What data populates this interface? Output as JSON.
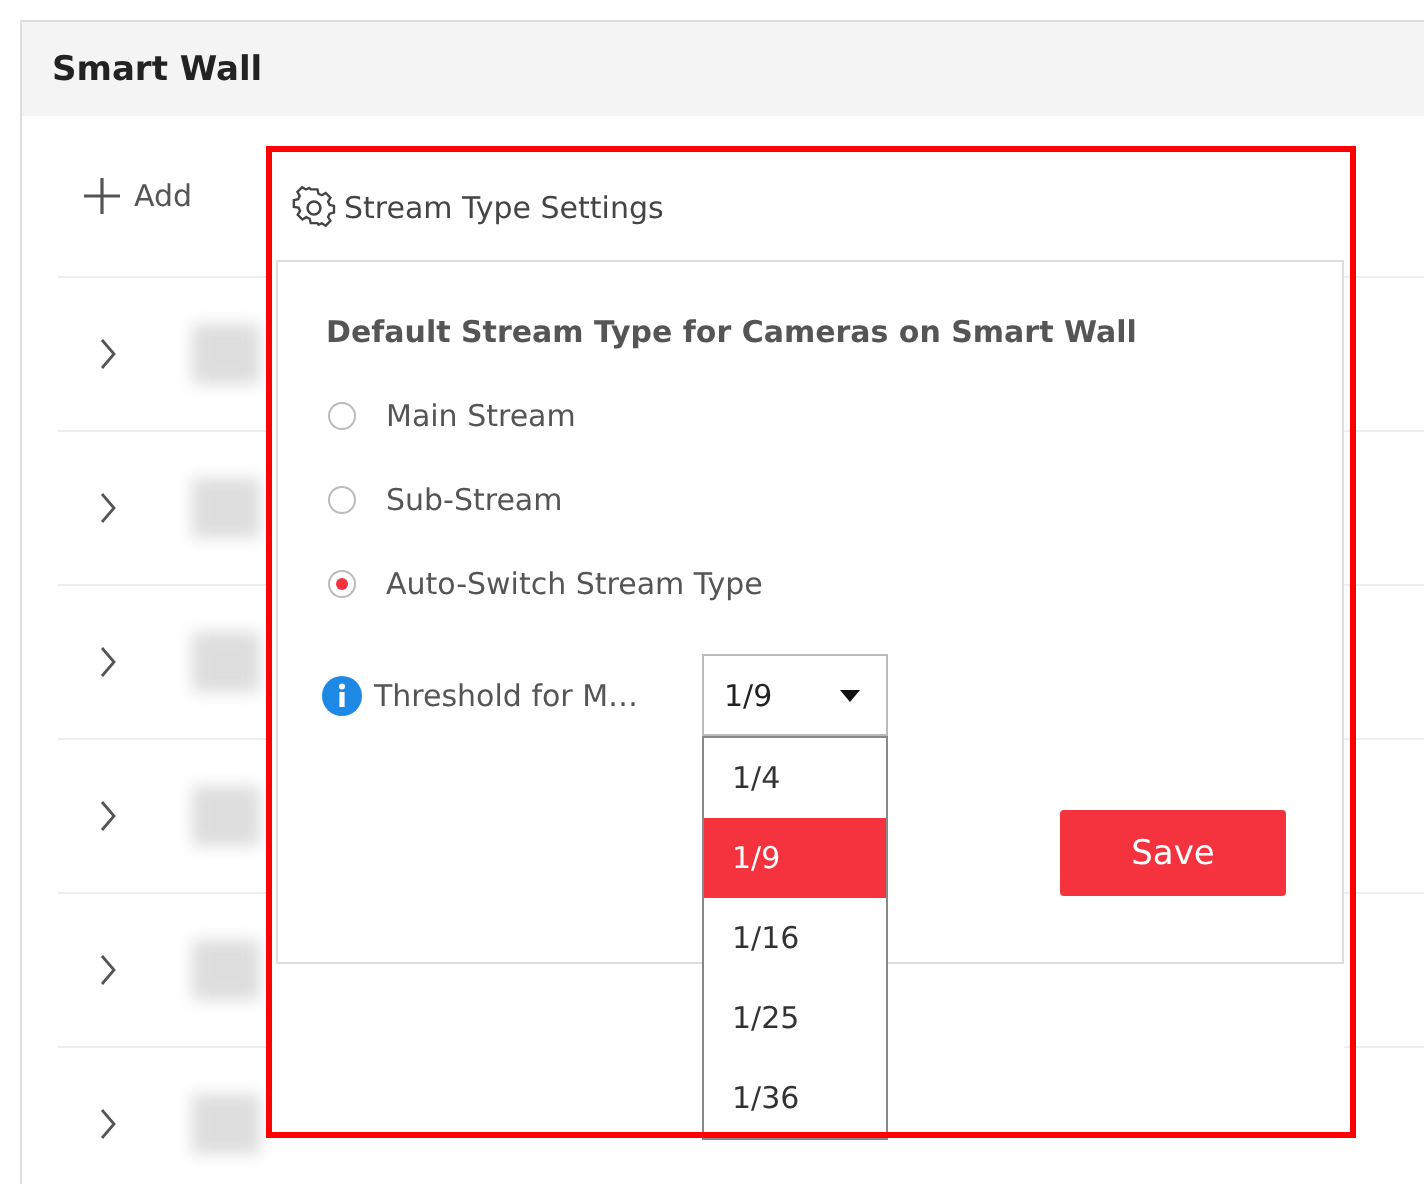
{
  "panel": {
    "title": "Smart Wall"
  },
  "toolbar": {
    "add_label": "Add"
  },
  "rows": [
    {
      "expanded": false
    },
    {
      "expanded": false
    },
    {
      "expanded": false
    },
    {
      "expanded": false
    },
    {
      "expanded": false
    },
    {
      "expanded": false
    }
  ],
  "popover": {
    "title": "Stream Type Settings",
    "section_title": "Default Stream Type for Cameras on Smart Wall",
    "stream_options": [
      {
        "label": "Main Stream",
        "selected": false
      },
      {
        "label": "Sub-Stream",
        "selected": false
      },
      {
        "label": "Auto-Switch Stream Type",
        "selected": true
      }
    ],
    "threshold": {
      "label": "Threshold for M…",
      "value": "1/9",
      "expanded": true,
      "options": [
        {
          "label": "1/4",
          "selected": false
        },
        {
          "label": "1/9",
          "selected": true
        },
        {
          "label": "1/16",
          "selected": false
        },
        {
          "label": "1/25",
          "selected": false
        },
        {
          "label": "1/36",
          "selected": false
        }
      ]
    },
    "save_button": "Save"
  }
}
